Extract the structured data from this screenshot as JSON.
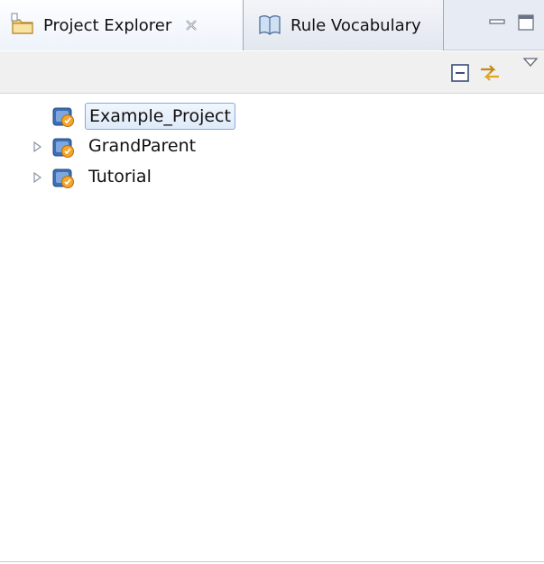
{
  "tabs": [
    {
      "label": "Project Explorer",
      "icon": "project-explorer-icon",
      "active": true,
      "close_icon": "close-icon"
    },
    {
      "label": "Rule Vocabulary",
      "icon": "rule-vocabulary-icon",
      "active": false
    }
  ],
  "view_controls": {
    "minimize": "minimize-icon",
    "maximize": "maximize-icon"
  },
  "toolbar": {
    "buttons": [
      {
        "icon": "collapse-all-icon"
      },
      {
        "icon": "link-with-editor-icon"
      },
      {
        "icon": "view-menu-icon"
      }
    ]
  },
  "tree": {
    "items": [
      {
        "label": "Example_Project",
        "expandable": false,
        "selected": true,
        "icon": "project-icon"
      },
      {
        "label": "GrandParent",
        "expandable": true,
        "selected": false,
        "icon": "project-icon"
      },
      {
        "label": "Tutorial",
        "expandable": true,
        "selected": false,
        "icon": "project-icon"
      }
    ]
  },
  "colors": {
    "tab_bar_bg": "#e7ebf3",
    "selection_border": "#84acdd",
    "selection_bg": "#dfeafa"
  }
}
